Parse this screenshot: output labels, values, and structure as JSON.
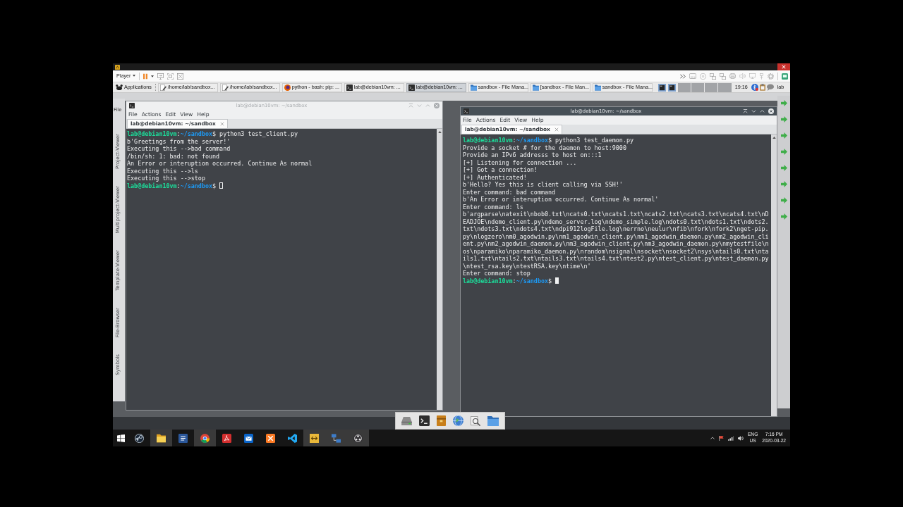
{
  "vm_player": {
    "menu_label": "Player"
  },
  "xfce_panel": {
    "menu_label": "Applications",
    "tasks": [
      {
        "label": "/home/lab/sandbox...",
        "kind": "editor",
        "selected": false
      },
      {
        "label": "/home/lab/sandbox...",
        "kind": "editor",
        "selected": false
      },
      {
        "label": "python - bash: pip: ...",
        "kind": "browser",
        "selected": false
      },
      {
        "label": "lab@debian10vm: ...",
        "kind": "terminal",
        "selected": false
      },
      {
        "label": "lab@debian10vm: ...",
        "kind": "terminal",
        "selected": true
      },
      {
        "label": "sandbox - File Mana...",
        "kind": "folder",
        "selected": false
      },
      {
        "label": "[sandbox - File Man...",
        "kind": "folder",
        "selected": false
      },
      {
        "label": "sandbox - File Mana...",
        "kind": "folder",
        "selected": false
      }
    ],
    "clock": "19:16",
    "user": "lab"
  },
  "ide": {
    "menu_label": "File",
    "side_tabs": [
      "Project-Viewer",
      "Multiproject-Viewer",
      "Template-Viewer",
      "File-Browser",
      "Symbols"
    ]
  },
  "windows": [
    {
      "title": "lab@debian10vm: ~/sandbox",
      "active": false,
      "menu": [
        "File",
        "Actions",
        "Edit",
        "View",
        "Help"
      ],
      "tabs": [
        {
          "label": "lab@debian10vm: ~/sandbox",
          "selected": true
        }
      ],
      "lines": [
        {
          "kind": "prompt",
          "user": "lab@debian10vm",
          "sep": ":",
          "path": "~/sandbox",
          "sign": "$",
          "command": "python3 test_client.py"
        },
        {
          "kind": "output",
          "text": "b'Greetings from the server!'"
        },
        {
          "kind": "output",
          "text": "Executing this -->bad command"
        },
        {
          "kind": "output",
          "text": "/bin/sh: 1: bad: not found"
        },
        {
          "kind": "output",
          "text": "An Error or interuption occurred. Continue As normal"
        },
        {
          "kind": "output",
          "text": "Executing this -->ls"
        },
        {
          "kind": "output",
          "text": "Executing this -->stop"
        },
        {
          "kind": "prompt",
          "user": "lab@debian10vm",
          "sep": ":",
          "path": "~/sandbox",
          "sign": "$",
          "cursor": true
        }
      ]
    },
    {
      "title": "lab@debian10vm: ~/sandbox",
      "active": true,
      "menu": [
        "File",
        "Actions",
        "Edit",
        "View",
        "Help"
      ],
      "tabs": [
        {
          "label": "lab@debian10vm: ~/sandbox",
          "selected": true
        }
      ],
      "lines": [
        {
          "kind": "prompt",
          "user": "lab@debian10vm",
          "sep": ":",
          "path": "~/sandbox",
          "sign": "$",
          "command": "python3 test_daemon.py"
        },
        {
          "kind": "output",
          "text": "Provide a socket # for the daemon to host:9000"
        },
        {
          "kind": "output",
          "text": "Provide an IPv6 addresss to host on:::1"
        },
        {
          "kind": "output",
          "text": "[+] Listening for connection ..."
        },
        {
          "kind": "output",
          "text": "[+] Got a connection!"
        },
        {
          "kind": "output",
          "text": "[+] Authenticated!"
        },
        {
          "kind": "output",
          "text": "b'Hello? Yes this is client calling via SSH!'"
        },
        {
          "kind": "output",
          "text": "Enter command: bad command"
        },
        {
          "kind": "output",
          "text": "b'An Error or interuption occurred. Continue As normal'"
        },
        {
          "kind": "output",
          "text": "Enter command: ls"
        },
        {
          "kind": "output",
          "text": "b'argparse\\natexit\\nbob0.txt\\ncats0.txt\\ncats1.txt\\ncats2.txt\\ncats3.txt\\ncats4.txt\\nDEADJOE\\ndemo_client.py\\ndemo_server.log\\ndemo_simple.log\\ndots0.txt\\ndots1.txt\\ndots2.txt\\ndots3.txt\\ndots4.txt\\ndpi912logFile.log\\nerrno\\neulur\\nfib\\nfork\\nfork2\\nget-pip.py\\nlogzero\\nm0_agodwin.py\\nm1_agodwin_client.py\\nm1_agodwin_daemon.py\\nm2_agodwin_client.py\\nm2_agodwin_daemon.py\\nm3_agodwin_client.py\\nm3_agodwin_daemon.py\\nmytestfile\\nos\\nparamiko\\nparamiko_daemon.py\\nrandom\\nsignal\\nsocket\\nsocket2\\nsys\\ntails0.txt\\ntails1.txt\\ntails2.txt\\ntails3.txt\\ntails4.txt\\ntest2.py\\ntest_client.py\\ntest_daemon.py\\ntest_rsa.key\\ntestRSA.key\\ntime\\n'"
        },
        {
          "kind": "output",
          "text": "Enter command: stop"
        },
        {
          "kind": "prompt",
          "user": "lab@debian10vm",
          "sep": ":",
          "path": "~/sandbox",
          "sign": "$",
          "cursor": true
        }
      ]
    }
  ],
  "taskbar": {
    "apps": [
      {
        "kind": "gamepad",
        "running": false
      },
      {
        "kind": "folder",
        "running": true
      },
      {
        "kind": "document",
        "running": false
      },
      {
        "kind": "browser",
        "running": true
      },
      {
        "kind": "pdf",
        "running": false
      },
      {
        "kind": "mail",
        "running": false
      },
      {
        "kind": "stack",
        "running": false
      },
      {
        "kind": "code",
        "running": false
      },
      {
        "kind": "tools",
        "running": true
      },
      {
        "kind": "network",
        "running": true
      },
      {
        "kind": "recorder",
        "running": true
      }
    ],
    "tray": {
      "language": "ENG",
      "layout": "US",
      "time": "7:16 PM",
      "date": "2020-03-22"
    }
  }
}
